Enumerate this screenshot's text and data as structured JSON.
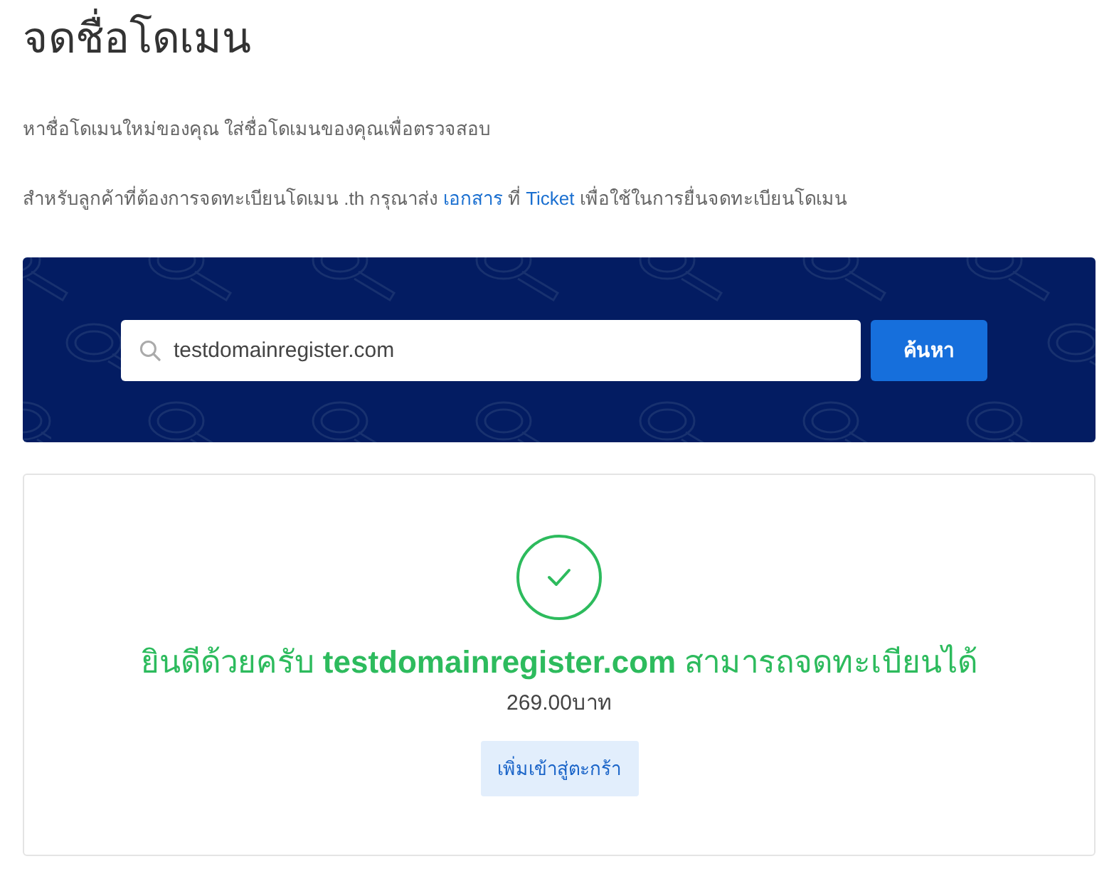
{
  "page": {
    "title": "จดชื่อโดเมน",
    "intro": "หาชื่อโดเมนใหม่ของคุณ ใส่ชื่อโดเมนของคุณเพื่อตรวจสอบ",
    "note": [
      {
        "kind": "text",
        "text": "สำหรับลูกค้าที่ต้องการจดทะเบียนโดเมน .th กรุณาส่ง"
      },
      {
        "kind": "link",
        "text": "เอกสาร"
      },
      {
        "kind": "text",
        "text": "ที่"
      },
      {
        "kind": "link",
        "text": "Ticket"
      },
      {
        "kind": "text",
        "text": "เพื่อใช้ในการยื่นจดทะเบียนโดเมน"
      }
    ]
  },
  "search": {
    "value": "testdomainregister.com",
    "button": "ค้นหา"
  },
  "result": {
    "available": true,
    "message": "ยินดีด้วยครับ **testdomainregister.com** สามารถจดทะเบียนได้",
    "price": "269.00บาท",
    "button": "เพิ่มเข้าสู่ตะกร้า"
  }
}
